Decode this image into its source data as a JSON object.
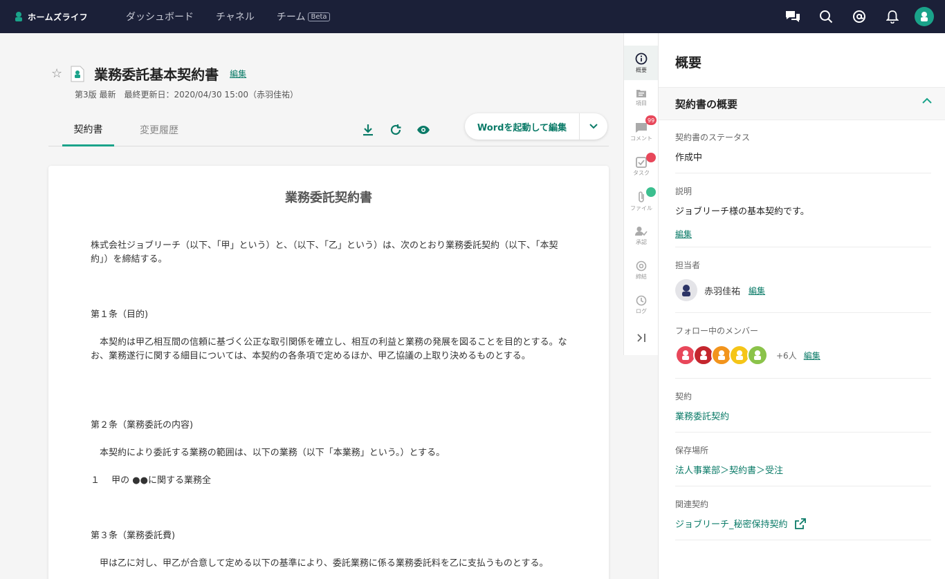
{
  "nav": {
    "brand": "ホームズライフ",
    "links": [
      "ダッシュボード",
      "チャネル",
      "チーム"
    ],
    "beta": "Beta"
  },
  "doc": {
    "title": "業務委託基本契約書",
    "edit": "編集",
    "meta": "第3版 最新　最終更新日：2020/04/30 15:00（赤羽佳祐）",
    "tabs": [
      "契約書",
      "変更履歴"
    ],
    "word_button": "Wordを起動して編集"
  },
  "paper": {
    "title": "業務委託契約書",
    "p1": "株式会社ジョブリーチ（以下、「甲」という）と、（以下、「乙」という）は、次のとおり業務委託契約（以下、「本契約」）を締結する。",
    "a1": "第１条（目的)",
    "p2": "　本契約は甲乙相互間の信頼に基づく公正な取引関係を確立し、相互の利益と業務の発展を図ることを目的とする。なお、業務遂行に関する細目については、本契約の各条項で定めるほか、甲乙協議の上取り決めるものとする。",
    "a2": "第２条（業務委託の内容)",
    "p3": "　本契約により委託する業務の範囲は、以下の業務（以下「本業務」という。）とする。",
    "p4": "１　 甲の ●●に関する業務全",
    "a3": "第３条（業務委託費)",
    "p5": "　甲は乙に対し、甲乙が合意して定める以下の基準により、委託業務に係る業務委託料を乙に支払うものとする。"
  },
  "rail": {
    "items": [
      "概要",
      "項目",
      "コメント",
      "タスク",
      "ファイル",
      "承認",
      "締結",
      "ログ"
    ],
    "comment_badge": "99"
  },
  "panel": {
    "title": "概要",
    "section": "契約書の概要",
    "status_label": "契約書のステータス",
    "status_value": "作成中",
    "desc_label": "説明",
    "desc_value": "ジョブリーチ様の基本契約です。",
    "edit": "編集",
    "owner_label": "担当者",
    "owner_name": "赤羽佳祐",
    "followers_label": "フォロー中のメンバー",
    "followers_more": "+6人",
    "contract_label": "契約",
    "contract_value": "業務委託契約",
    "location_label": "保存場所",
    "location_value": "法人事業部＞契約書＞受注",
    "related_label": "関連契約",
    "related_value": "ジョブリーチ_秘密保持契約"
  },
  "colors": {
    "accent": "#1aa38a",
    "nav_bg": "#1b2038",
    "link": "#0b7b68",
    "follower_colors": [
      "#e8475a",
      "#c4262e",
      "#f2941c",
      "#f5c518",
      "#8bc34a"
    ]
  }
}
